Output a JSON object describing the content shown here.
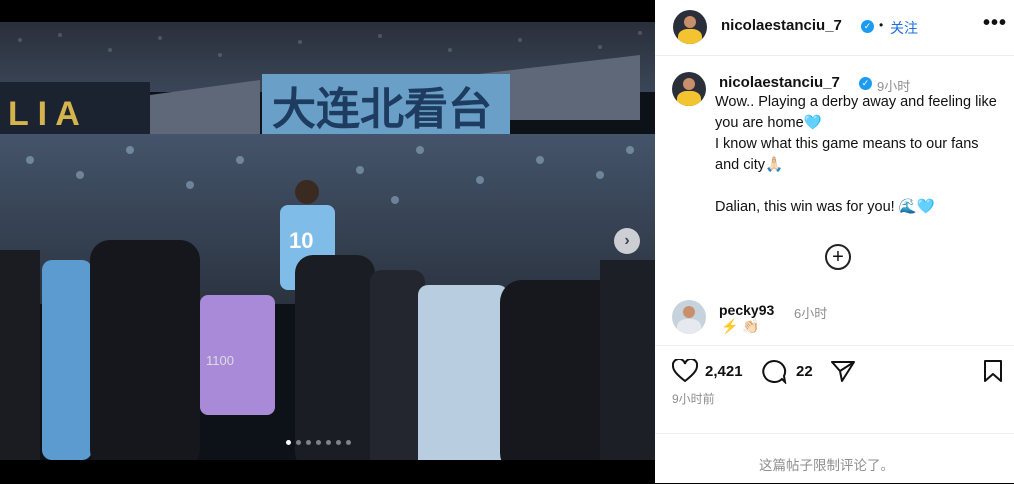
{
  "header": {
    "username": "nicolaestanciu_7",
    "separator": "•",
    "follow_label": "关注",
    "more_label": "•••"
  },
  "post": {
    "author": "nicolaestanciu_7",
    "time": "9小时",
    "caption": [
      "Wow.. Playing a derby away and feeling like you are home🩵",
      "I know what this game means to our fans and city🙏🏻",
      "",
      "Dalian, this win was for you! 🌊🩵"
    ]
  },
  "photo": {
    "banner_text": "大连北看台",
    "jersey_number": "10",
    "vest_number": "1100",
    "carousel_dots": 7,
    "active_dot": 0
  },
  "comment": {
    "username": "pecky93",
    "time": "6小时",
    "text": "⚡ 👏🏻"
  },
  "stats": {
    "likes": "2,421",
    "comments": "22"
  },
  "post_date": "9小时前",
  "footer": {
    "limit_notice": "这篇帖子限制评论了。"
  },
  "colors": {
    "accent": "#1d6fe0",
    "verified": "#1d9bf0",
    "jersey": "#7fbde8"
  }
}
